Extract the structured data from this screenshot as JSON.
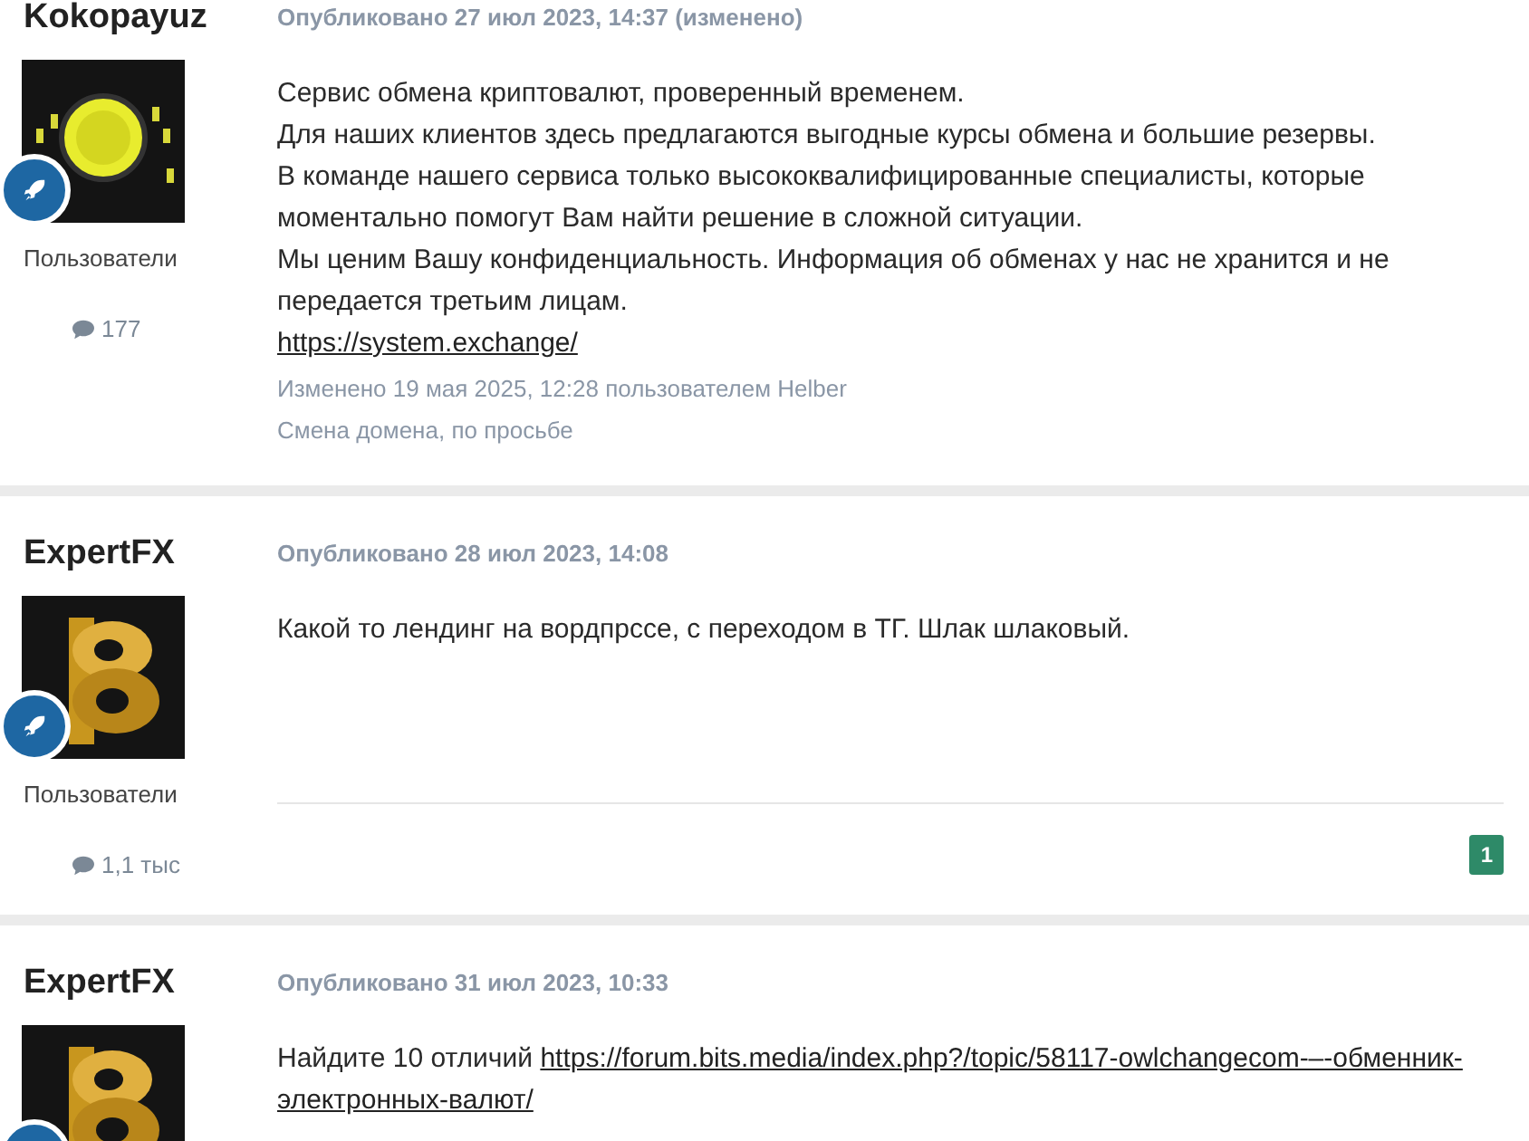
{
  "posts": [
    {
      "author": "Kokopayuz",
      "role": "Пользователи",
      "post_count": "177",
      "date": "Опубликовано 27 июл 2023, 14:37 (изменено)",
      "body": [
        [
          {
            "kind": "text",
            "text": "Сервис обмена криптовалют, проверенный временем."
          }
        ],
        [
          {
            "kind": "text",
            "text": "Для наших клиентов здесь предлагаются выгодные курсы обмена и большие резервы."
          }
        ],
        [
          {
            "kind": "text",
            "text": "В команде нашего сервиса только высококвалифицированные специалисты, которые моментально помогут Вам найти решение в сложной ситуации."
          }
        ],
        [
          {
            "kind": "text",
            "text": "Мы ценим Вашу конфиденциальность. Информация об обменах у нас не хранится и не передается третьим лицам."
          }
        ],
        [
          {
            "kind": "link",
            "text": "https://system.exchange/"
          }
        ]
      ],
      "edit_note": "Изменено 19 мая 2025, 12:28 пользователем Helber",
      "edit_reason": "Смена домена, по просьбе"
    },
    {
      "author": "ExpertFX",
      "role": "Пользователи",
      "post_count": "1,1 тыс",
      "date": "Опубликовано 28 июл 2023, 14:08",
      "body": [
        [
          {
            "kind": "text",
            "text": "Какой то лендинг на вордпрссе, с переходом в ТГ. Шлак шлаковый."
          }
        ]
      ],
      "reactions": [
        {
          "count": "1"
        }
      ]
    },
    {
      "author": "ExpertFX",
      "date": "Опубликовано 31 июл 2023, 10:33",
      "body": [
        [
          {
            "kind": "text",
            "text": "Найдите 10 отличий "
          },
          {
            "kind": "link",
            "text": "https://forum.bits.media/index.php?/topic/58117-owlchangecom-–-обменник-"
          },
          {
            "kind": "link",
            "text": "электронных-валют/"
          }
        ]
      ]
    }
  ]
}
